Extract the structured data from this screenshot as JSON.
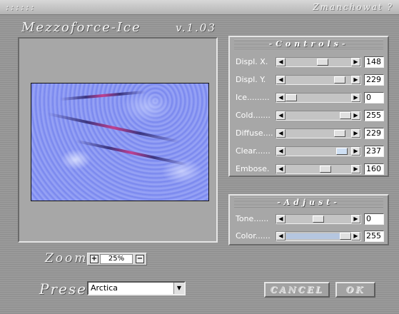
{
  "titlebar": {
    "left": "::::::",
    "right": "Zmanchowat ?"
  },
  "header": {
    "app_name": "Mezzoforce-Ice",
    "version": "v.1.03"
  },
  "controls": {
    "title": "-Controls-",
    "rows": [
      {
        "label": "Displ. X.",
        "value": "148",
        "level": 0.58
      },
      {
        "label": "Displ. Y.",
        "value": "229",
        "level": 0.9
      },
      {
        "label": "Ice.........",
        "value": "0",
        "level": 0.0
      },
      {
        "label": "Cold.......",
        "value": "255",
        "level": 1.0
      },
      {
        "label": "Diffuse....",
        "value": "229",
        "level": 0.9
      },
      {
        "label": "Clear......",
        "value": "237",
        "level": 0.93
      },
      {
        "label": "Embose.",
        "value": "160",
        "level": 0.63
      }
    ]
  },
  "adjust": {
    "title": "-Adjust-",
    "rows": [
      {
        "label": "Tone......",
        "value": "0",
        "level": 0.5
      },
      {
        "label": "Color......",
        "value": "255",
        "level": 1.0
      }
    ]
  },
  "zoom": {
    "label": "Zoom",
    "value": "25%",
    "plus": "+",
    "minus": "−"
  },
  "preset": {
    "label": "Preset",
    "selected": "Arctica"
  },
  "buttons": {
    "cancel": "CANCEL",
    "ok": "OK"
  },
  "colors": {
    "fill_color": "#b5c6e0",
    "background": "#9a9a9a"
  }
}
